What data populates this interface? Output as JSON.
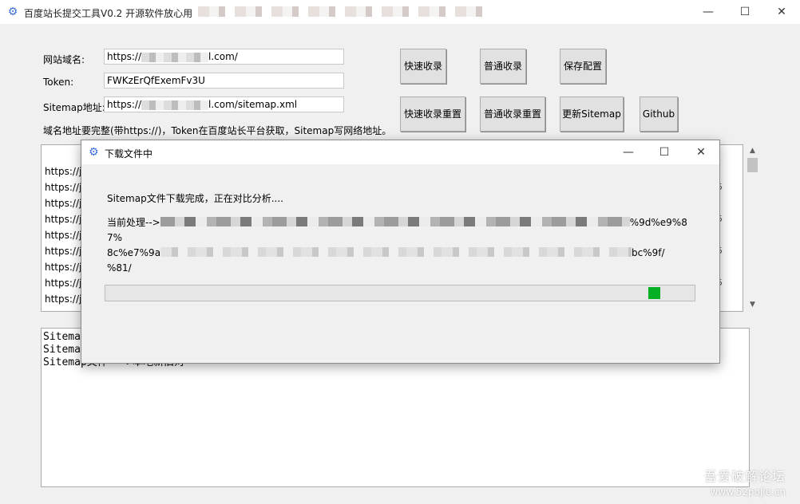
{
  "window": {
    "icon": "gear-icon",
    "title": "百度站长提交工具V0.2 开源软件放心用",
    "minimize": "—",
    "maximize": "☐",
    "close": "✕"
  },
  "form": {
    "domain_label": "网站域名:",
    "domain_value_start": "https://",
    "domain_value_end": "l.com/",
    "token_label": "Token:",
    "token_value": "FWKzErQfExemFv3U",
    "sitemap_label": "Sitemap地址:",
    "sitemap_value_start": "https://",
    "sitemap_value_end": "l.com/sitemap.xml",
    "hint": "域名地址要完整(带https://)，Token在百度站长平台获取，Sitemap写网络地址。"
  },
  "buttons": {
    "fast_submit": "快速收录",
    "normal_submit": "普通收录",
    "save_config": "保存配置",
    "fast_reset": "快速收录重置",
    "normal_reset": "普通收录重置",
    "update_sitemap": "更新Sitemap",
    "github": "Github"
  },
  "url_list": {
    "rows": [
      "https://j",
      "https://j",
      "https://j",
      "https://j",
      "https://j",
      "https://j",
      "https://j",
      "https://j",
      "https://j"
    ],
    "row_suffix": "5"
  },
  "log": {
    "lines": [
      "Sitema",
      "Sitema",
      "Sitemap文件 -->本地新旧对"
    ]
  },
  "watermark": {
    "line1": "吾爱破解论坛",
    "line2": "www.52pojie.cn"
  },
  "dialog": {
    "title": "下载文件中",
    "status": "Sitemap文件下载完成，正在对比分析....",
    "processing_prefix": "当前处理-->",
    "processing_seg1": "%9d%e9%87%",
    "processing_seg2": "8c%e7%9a",
    "processing_seg3": "bc%9f/",
    "processing_seg4": "%81/",
    "progress_fraction": 0.94,
    "progress_color": "#06b025"
  }
}
